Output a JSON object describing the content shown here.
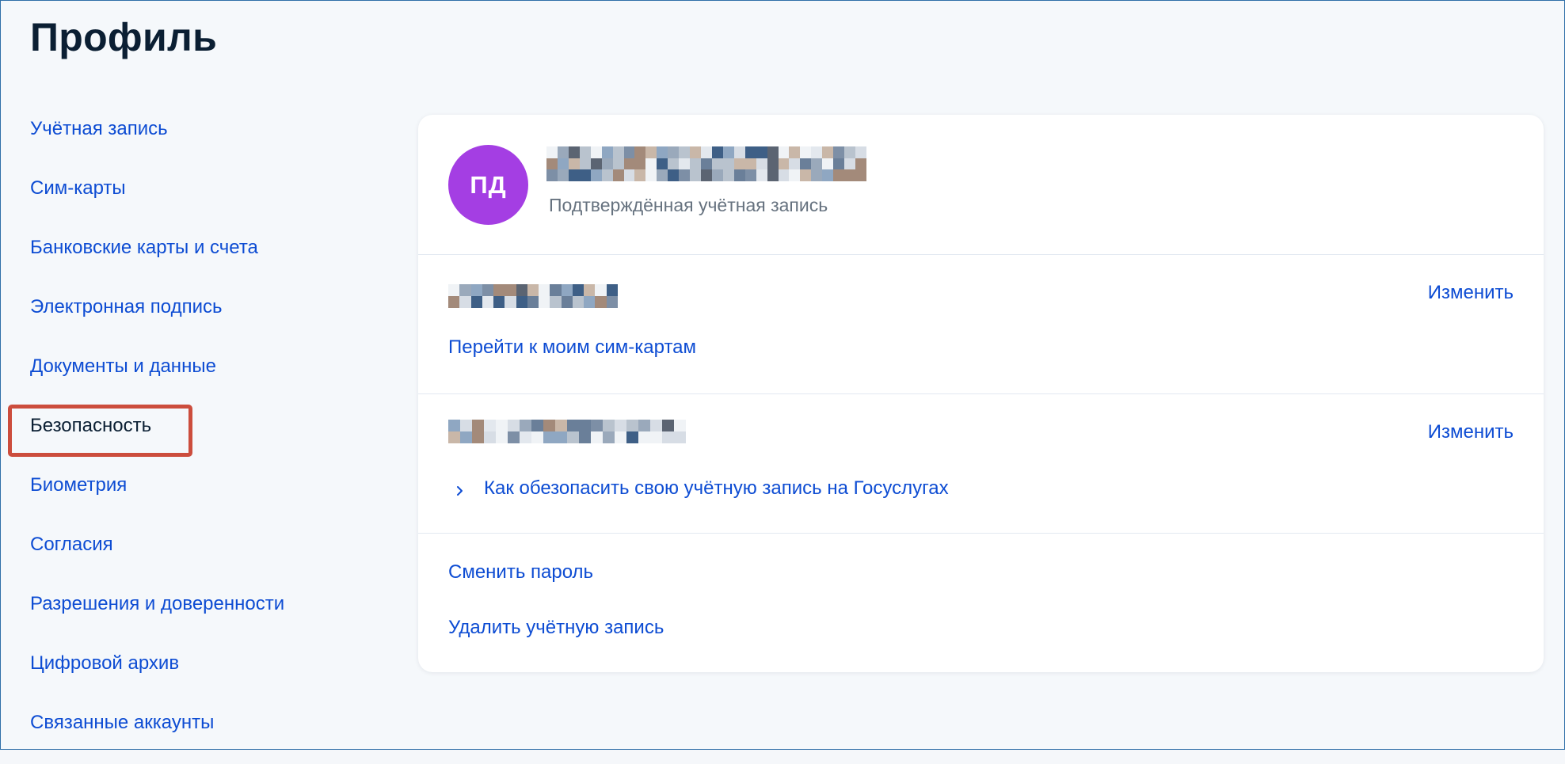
{
  "page": {
    "title": "Профиль"
  },
  "sidebar": {
    "items": [
      {
        "label": "Учётная запись"
      },
      {
        "label": "Сим-карты"
      },
      {
        "label": "Банковские карты и счета"
      },
      {
        "label": "Электронная подпись"
      },
      {
        "label": "Документы и данные"
      },
      {
        "label": "Безопасность",
        "active": true
      },
      {
        "label": "Биометрия"
      },
      {
        "label": "Согласия"
      },
      {
        "label": "Разрешения и доверенности"
      },
      {
        "label": "Цифровой архив"
      },
      {
        "label": "Связанные аккаунты"
      }
    ]
  },
  "profile": {
    "avatar_initials": "ПД",
    "status": "Подтверждённая учётная запись"
  },
  "phone_section": {
    "change_label": "Изменить",
    "link_label": "Перейти к моим сим-картам"
  },
  "email_section": {
    "change_label": "Изменить",
    "link_label": "Как обезопасить свою учётную запись на Госуслугах"
  },
  "actions": {
    "change_password": "Сменить пароль",
    "delete_account": "Удалить учётную запись"
  },
  "colors": {
    "accent": "#0d4cd3",
    "avatar": "#a43ee3",
    "highlight": "#cc4d3d",
    "title": "#0b1f33"
  },
  "icons": {
    "expand": "chevron-right-icon"
  }
}
